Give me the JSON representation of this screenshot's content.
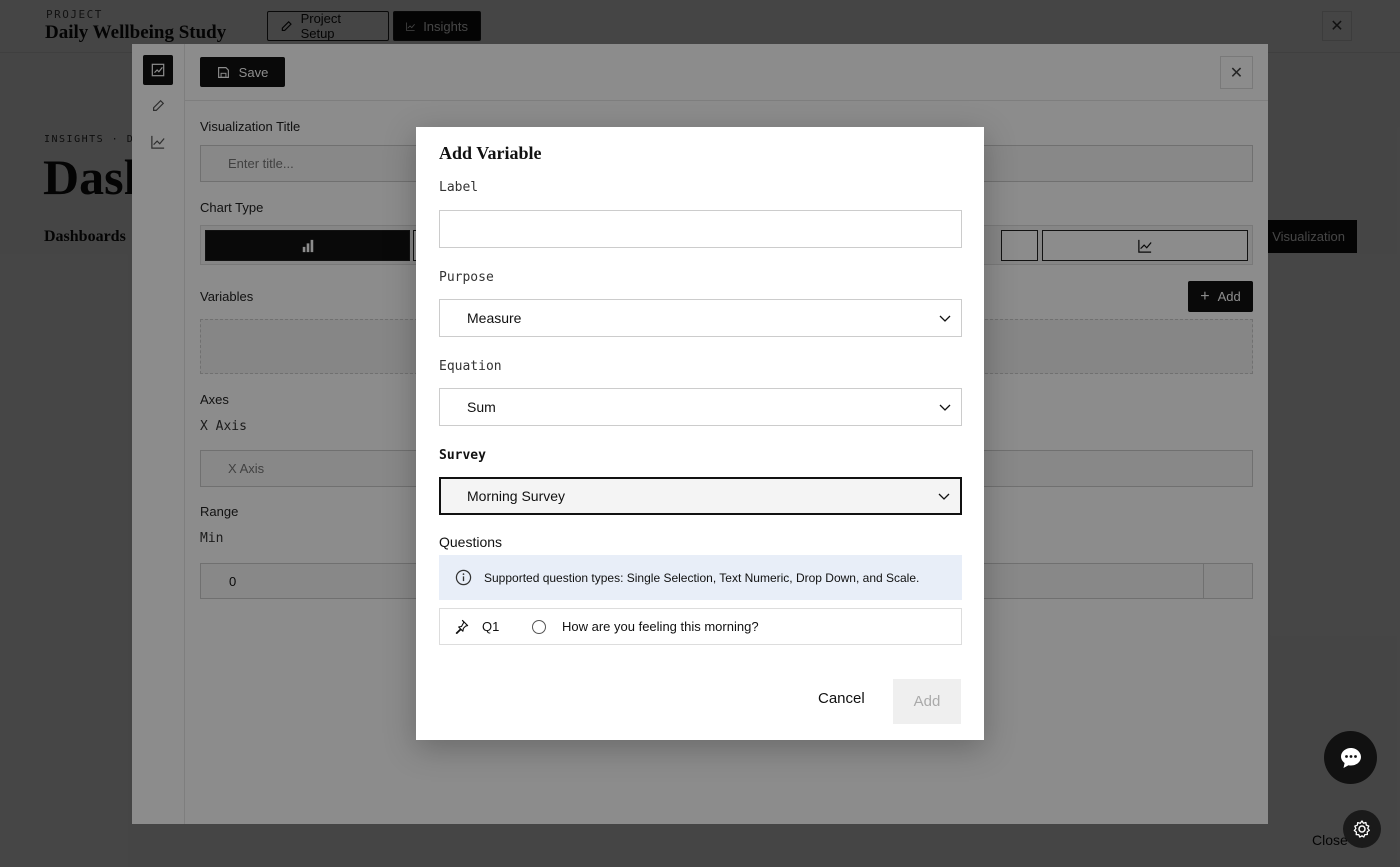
{
  "project": {
    "label": "PROJECT",
    "name": "Daily Wellbeing Study",
    "tabs": [
      {
        "label": "Project Setup",
        "icon": "pencil-icon"
      },
      {
        "label": "Insights",
        "icon": "line-chart-icon"
      }
    ]
  },
  "page": {
    "breadcrumb": "INSIGHTS · DA",
    "title": "Dash",
    "dashboards_tab": "Dashboards",
    "new_viz_label": "Visualization",
    "bottom_close": "Close"
  },
  "drawer": {
    "save_label": "Save",
    "rail_icons": [
      "chart-edit-icon",
      "pencil-icon",
      "line-chart-icon"
    ],
    "viz_title_label": "Visualization Title",
    "viz_title_placeholder": "Enter title...",
    "chart_type_label": "Chart Type",
    "chart_types": [
      "bar-chart-icon",
      "line-chart-icon"
    ],
    "variables_label": "Variables",
    "variables_add": "Add",
    "axes_label": "Axes",
    "x_axis_label": "X Axis",
    "x_axis_placeholder": "X Axis",
    "range_label": "Range",
    "min_label": "Min",
    "min_value": "0"
  },
  "modal": {
    "title": "Add Variable",
    "label_field": {
      "label": "Label",
      "value": ""
    },
    "purpose": {
      "label": "Purpose",
      "value": "Measure"
    },
    "equation": {
      "label": "Equation",
      "value": "Sum"
    },
    "survey": {
      "label": "Survey",
      "value": "Morning Survey"
    },
    "questions_label": "Questions",
    "info_text": "Supported question types: Single Selection, Text Numeric, Drop Down, and Scale.",
    "questions": [
      {
        "id": "Q1",
        "text": "How are you feeling this morning?"
      }
    ],
    "cancel_label": "Cancel",
    "add_label": "Add"
  }
}
